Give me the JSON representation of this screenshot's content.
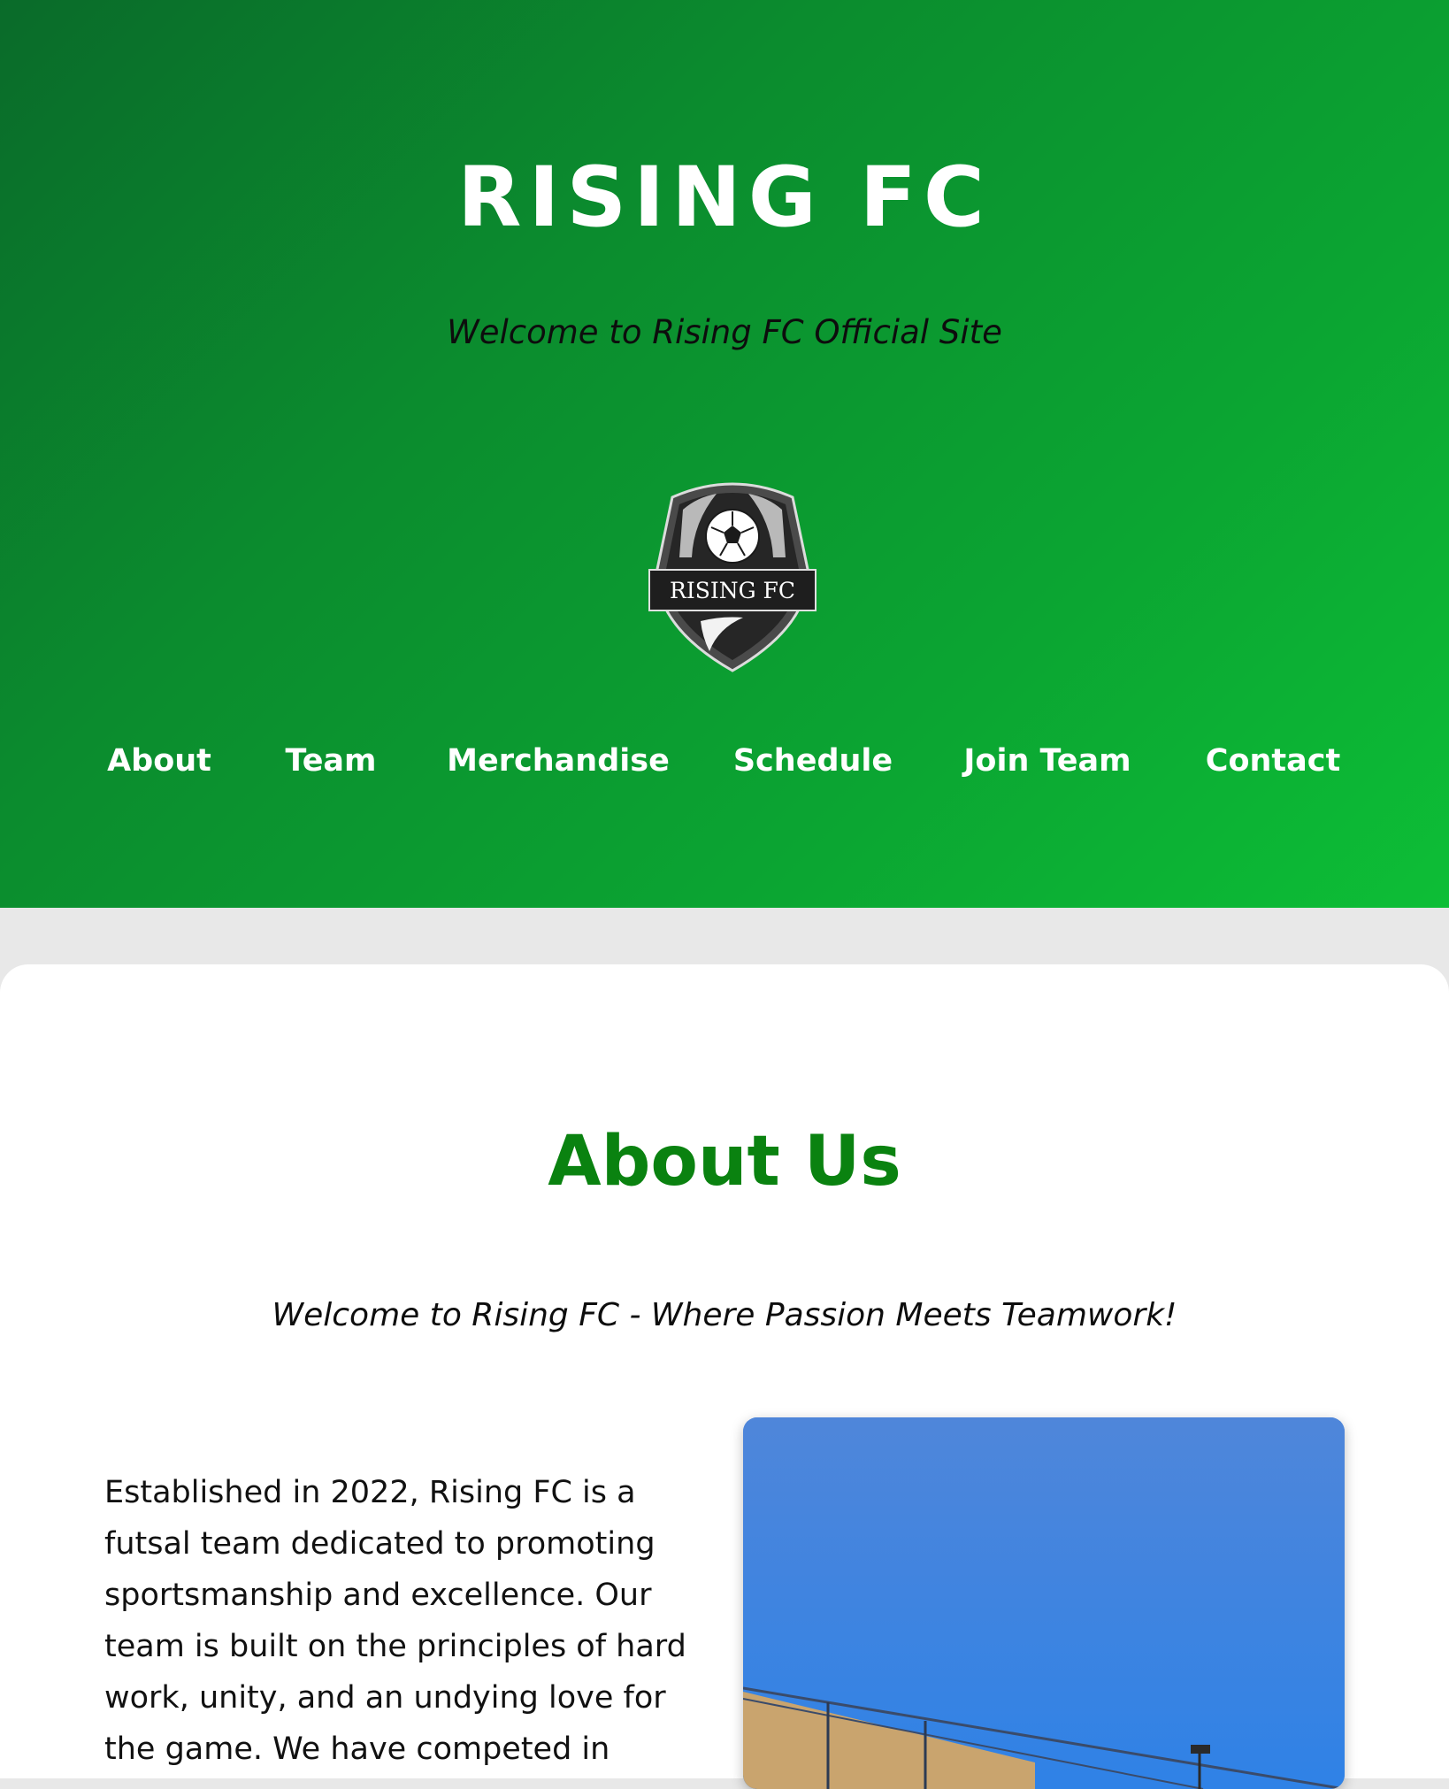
{
  "header": {
    "title": "RISING FC",
    "subtitle": "Welcome to Rising FC Official Site",
    "crest_text": "RISING FC"
  },
  "nav": {
    "items": [
      {
        "label": "About"
      },
      {
        "label": "Team"
      },
      {
        "label": "Merchandise"
      },
      {
        "label": "Schedule"
      },
      {
        "label": "Join Team"
      },
      {
        "label": "Contact"
      }
    ]
  },
  "about": {
    "heading": "About Us",
    "tagline": "Welcome to Rising FC - Where Passion Meets Teamwork!",
    "body": "Established in 2022, Rising FC is a futsal team dedicated to promoting sportsmanship and excellence. Our team is built on the principles of hard work, unity, and an undying love for the game. We have competed in"
  },
  "colors": {
    "hero_gradient_start": "#0a6b2a",
    "hero_gradient_end": "#0dbe36",
    "heading_green": "#0a8210",
    "page_background": "#e8e8e8"
  },
  "icons": {
    "crest": "soccer-crest-icon"
  }
}
